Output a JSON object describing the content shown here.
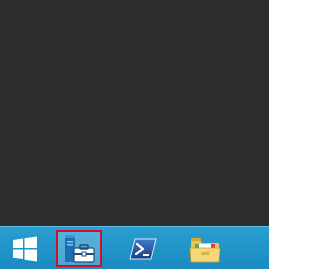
{
  "taskbar": {
    "background": "#1f93c8",
    "items": [
      {
        "name": "start",
        "icon": "windows-logo-icon"
      },
      {
        "name": "server-manager",
        "icon": "server-manager-icon",
        "highlighted": true,
        "highlight_color": "#d0102a"
      },
      {
        "name": "powershell",
        "icon": "powershell-icon"
      },
      {
        "name": "file-explorer",
        "icon": "folder-icon"
      }
    ]
  }
}
